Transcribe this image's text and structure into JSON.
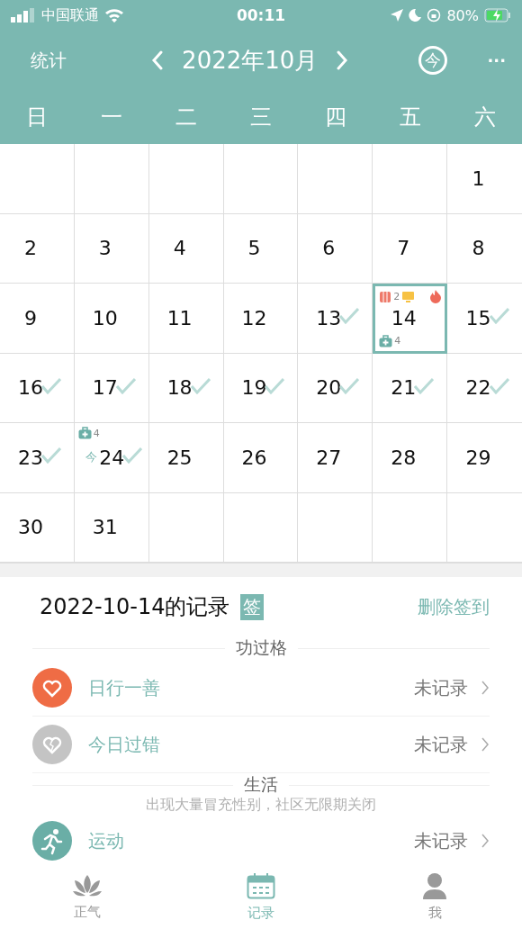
{
  "status_bar": {
    "carrier": "中国联通",
    "time": "00:11",
    "battery": "80%"
  },
  "header": {
    "left_button": "统计",
    "month": "2022年10月",
    "today_button": "今",
    "more_button": "···"
  },
  "weekdays": [
    "日",
    "一",
    "二",
    "三",
    "四",
    "五",
    "六"
  ],
  "calendar": {
    "cells": [
      {
        "kind": "blank"
      },
      {
        "kind": "blank"
      },
      {
        "kind": "blank"
      },
      {
        "kind": "blank"
      },
      {
        "kind": "blank"
      },
      {
        "kind": "blank"
      },
      {
        "kind": "day",
        "day": "1",
        "checked": false,
        "selected": false
      },
      {
        "kind": "day",
        "day": "2",
        "checked": false,
        "selected": false
      },
      {
        "kind": "day",
        "day": "3",
        "checked": false,
        "selected": false
      },
      {
        "kind": "day",
        "day": "4",
        "checked": false,
        "selected": false
      },
      {
        "kind": "day",
        "day": "5",
        "checked": false,
        "selected": false
      },
      {
        "kind": "day",
        "day": "6",
        "checked": false,
        "selected": false
      },
      {
        "kind": "day",
        "day": "7",
        "checked": false,
        "selected": false
      },
      {
        "kind": "day",
        "day": "8",
        "checked": false,
        "selected": false
      },
      {
        "kind": "day",
        "day": "9",
        "checked": false,
        "selected": false
      },
      {
        "kind": "day",
        "day": "10",
        "checked": false,
        "selected": false
      },
      {
        "kind": "day",
        "day": "11",
        "checked": false,
        "selected": false
      },
      {
        "kind": "day",
        "day": "12",
        "checked": false,
        "selected": false
      },
      {
        "kind": "day",
        "day": "13",
        "checked": true,
        "selected": false
      },
      {
        "kind": "day",
        "day": "14",
        "checked": false,
        "selected": true,
        "top_badges": [
          {
            "kind": "book",
            "count": "2"
          },
          {
            "kind": "screen"
          },
          {
            "kind": "fire"
          }
        ],
        "bottom_badges": [
          {
            "kind": "medkit",
            "count": "4"
          }
        ]
      },
      {
        "kind": "day",
        "day": "15",
        "checked": true,
        "selected": false
      },
      {
        "kind": "day",
        "day": "16",
        "checked": true,
        "selected": false
      },
      {
        "kind": "day",
        "day": "17",
        "checked": true,
        "selected": false
      },
      {
        "kind": "day",
        "day": "18",
        "checked": true,
        "selected": false
      },
      {
        "kind": "day",
        "day": "19",
        "checked": true,
        "selected": false
      },
      {
        "kind": "day",
        "day": "20",
        "checked": true,
        "selected": false
      },
      {
        "kind": "day",
        "day": "21",
        "checked": true,
        "selected": false
      },
      {
        "kind": "day",
        "day": "22",
        "checked": true,
        "selected": false
      },
      {
        "kind": "day",
        "day": "23",
        "checked": true,
        "selected": false
      },
      {
        "kind": "day",
        "day": "24",
        "checked": true,
        "selected": false,
        "today_label": "今",
        "top_badges": [
          {
            "kind": "medkit",
            "count": "4"
          }
        ]
      },
      {
        "kind": "day",
        "day": "25",
        "checked": false,
        "selected": false
      },
      {
        "kind": "day",
        "day": "26",
        "checked": false,
        "selected": false
      },
      {
        "kind": "day",
        "day": "27",
        "checked": false,
        "selected": false
      },
      {
        "kind": "day",
        "day": "28",
        "checked": false,
        "selected": false
      },
      {
        "kind": "day",
        "day": "29",
        "checked": false,
        "selected": false
      },
      {
        "kind": "day",
        "day": "30",
        "checked": false,
        "selected": false
      },
      {
        "kind": "day",
        "day": "31",
        "checked": false,
        "selected": false
      },
      {
        "kind": "blank"
      },
      {
        "kind": "blank"
      },
      {
        "kind": "blank"
      },
      {
        "kind": "blank"
      },
      {
        "kind": "blank"
      }
    ]
  },
  "record": {
    "title": "2022-10-14的记录",
    "sign_badge": "签",
    "delete_link": "删除签到",
    "groups": [
      {
        "title": "功过格",
        "items": [
          {
            "kind": "heart",
            "label": "日行一善",
            "status": "未记录"
          },
          {
            "kind": "broken_heart",
            "label": "今日过错",
            "status": "未记录"
          }
        ]
      },
      {
        "title": "生活",
        "items": [
          {
            "kind": "runner",
            "label": "运动",
            "status": "未记录"
          }
        ]
      }
    ],
    "toast": "出现大量冒充性别，社区无限期关闭"
  },
  "tabs": [
    {
      "label": "正气",
      "kind": "lotus",
      "selected": false
    },
    {
      "label": "记录",
      "kind": "calendar",
      "selected": true
    },
    {
      "label": "我",
      "kind": "person",
      "selected": false
    }
  ]
}
